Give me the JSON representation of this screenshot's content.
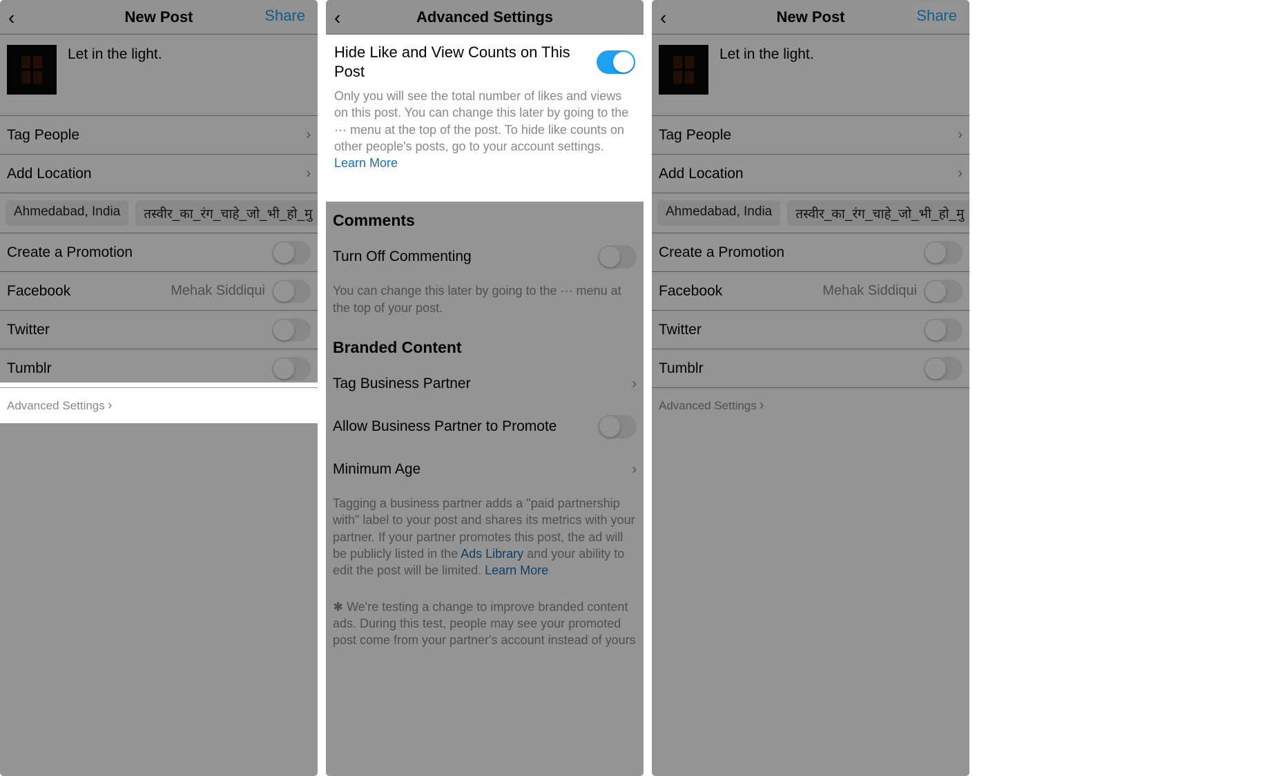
{
  "pane1": {
    "header": {
      "title": "New Post",
      "share": "Share"
    },
    "caption": "Let in the light.",
    "tag_people": "Tag People",
    "add_location": "Add Location",
    "chips": [
      "Ahmedabad, India",
      "तस्वीर_का_रंग_चाहे_जो_भी_हो_मु"
    ],
    "create_promotion": "Create a Promotion",
    "facebook": {
      "label": "Facebook",
      "account": "Mehak Siddiqui"
    },
    "twitter": "Twitter",
    "tumblr": "Tumblr",
    "advanced_settings": "Advanced Settings"
  },
  "pane2": {
    "header": {
      "title": "Advanced Settings"
    },
    "hide_counts": {
      "title": "Hide Like and View Counts on This Post",
      "desc": "Only you will see the total number of likes and views on this post. You can change this later by going to the ··· menu at the top of the post. To hide like counts on other people's posts, go to your account settings.",
      "learn_more": "Learn More"
    },
    "comments_hdr": "Comments",
    "turn_off_commenting": "Turn Off Commenting",
    "comments_desc": "You can change this later by going to the ··· menu at the top of your post.",
    "branded_hdr": "Branded Content",
    "tag_partner": "Tag Business Partner",
    "allow_promote": "Allow Business Partner to Promote",
    "min_age": "Minimum Age",
    "branded_desc_pre": "Tagging a business partner adds a \"paid partnership with\" label to your post and shares its metrics with your partner. If your partner promotes this post, the ad will be publicly listed in the ",
    "ads_library": "Ads Library",
    "branded_desc_post": " and your ability to edit the post will be limited. ",
    "learn_more2": "Learn More",
    "footer_text": "✱ We're testing a change to improve branded content ads. During this test, people may see your promoted post come from your partner's account instead of yours"
  },
  "pane3": {
    "header": {
      "title": "New Post",
      "share": "Share"
    },
    "caption": "Let in the light.",
    "tag_people": "Tag People",
    "add_location": "Add Location",
    "chips": [
      "Ahmedabad, India",
      "तस्वीर_का_रंग_चाहे_जो_भी_हो_मु"
    ],
    "create_promotion": "Create a Promotion",
    "facebook": {
      "label": "Facebook",
      "account": "Mehak Siddiqui"
    },
    "twitter": "Twitter",
    "tumblr": "Tumblr",
    "advanced_settings": "Advanced Settings"
  }
}
